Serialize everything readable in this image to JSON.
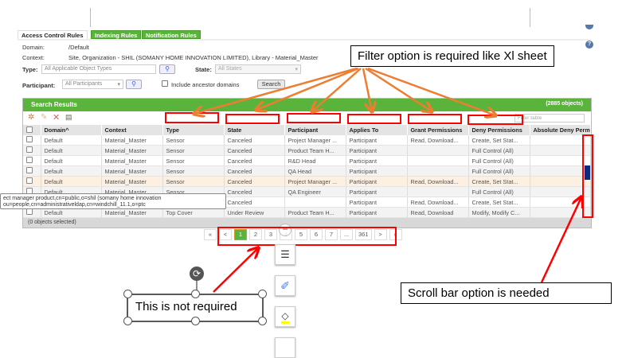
{
  "tabs": [
    "Access Control Rules",
    "Indexing Rules",
    "Notification Rules"
  ],
  "form": {
    "domain_label": "Domain:",
    "domain_value": "/Default",
    "context_label": "Context:",
    "context_value": "Site, Organization - SHIL (SOMANY HOME INNOVATION LIMITED), Library - Material_Master",
    "type_label": "Type:",
    "type_value": "All Applicable Object Types",
    "state_label": "State:",
    "state_value": "All States",
    "participant_label": "Participant:",
    "participant_value": "All Participants",
    "include_ancestor_label": "Include ancestor domains",
    "search_button": "Search"
  },
  "grid": {
    "title": "Search Results",
    "count": "(2885 objects)",
    "filter_placeholder": "Filter table",
    "columns": [
      "Domain^",
      "Context",
      "Type",
      "State",
      "Participant",
      "Applies To",
      "Grant Permissions",
      "Deny Permissions",
      "Absolute Deny Perm"
    ],
    "rows": [
      [
        "Default",
        "Material_Master",
        "Sensor",
        "Canceled",
        "Project Manager ...",
        "Participant",
        "Read, Download...",
        "Create, Set Stat...",
        ""
      ],
      [
        "Default",
        "Material_Master",
        "Sensor",
        "Canceled",
        "Product Team H...",
        "Participant",
        "",
        "Full Control (All)",
        ""
      ],
      [
        "Default",
        "Material_Master",
        "Sensor",
        "Canceled",
        "R&D Head",
        "Participant",
        "",
        "Full Control (All)",
        ""
      ],
      [
        "Default",
        "Material_Master",
        "Sensor",
        "Canceled",
        "QA Head",
        "Participant",
        "",
        "Full Control (All)",
        ""
      ],
      [
        "Default",
        "Material_Master",
        "Sensor",
        "Canceled",
        "Project Manager ...",
        "Participant",
        "Read, Download...",
        "Create, Set Stat...",
        ""
      ],
      [
        "Default",
        "Material_Master",
        "Sensor",
        "Canceled",
        "QA Engineer",
        "Participant",
        "",
        "Full Control (All)",
        ""
      ],
      [
        "Default",
        "Material_Master",
        "Sensor",
        "Canceled",
        "",
        "Participant",
        "Read, Download...",
        "Create, Set Stat...",
        ""
      ],
      [
        "Default",
        "Material_Master",
        "Top Cover",
        "Under Review",
        "Product Team H...",
        "Participant",
        "Read, Download",
        "Modify, Modify C...",
        ""
      ]
    ],
    "selected_text": "(0 objects selected)",
    "tooltip_line1": "ect manager product,cn=public,o=shil (somany home innovation",
    "tooltip_line2": "ou=people,cn=administrativeldap,cn=windchill_11.1,o=ptc"
  },
  "pagination": [
    "«",
    "<",
    "1",
    "2",
    "3",
    "4",
    "5",
    "6",
    "7",
    "...",
    "361",
    ">",
    "»"
  ],
  "current_page": "1",
  "annotations": {
    "filter_callout": "Filter option is required like Xl sheet",
    "not_required": "This is not required",
    "scrollbar_callout": "Scroll bar option is needed"
  },
  "colors": {
    "green": "#5ab43c",
    "red": "#ff0000",
    "orange": "#ed7d31"
  }
}
